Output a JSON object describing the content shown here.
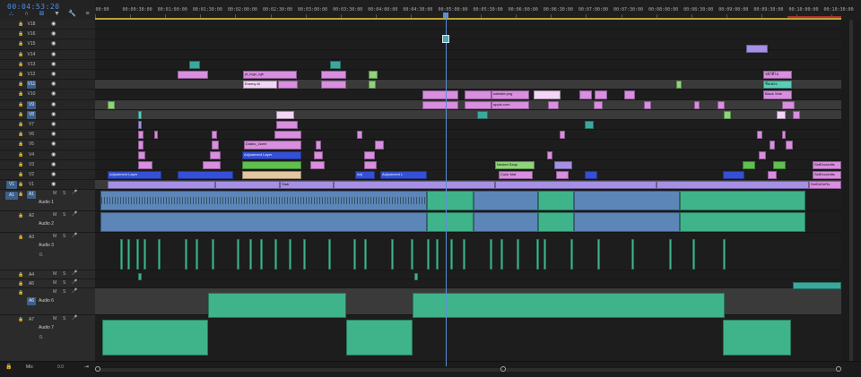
{
  "sequence": {
    "timecode": "00:04:53:20",
    "playhead_time": "00:04:53:20"
  },
  "toolbar": {
    "tools": [
      "snap-icon",
      "linked-selection-icon",
      "add-marker-icon",
      "marker-icon",
      "wrench-icon",
      "settings-icon"
    ]
  },
  "ruler": {
    "ticks": [
      "00:00",
      "00:00:30:00",
      "00:01:00:00",
      "00:01:30:00",
      "00:02:00:00",
      "00:02:30:00",
      "00:03:00:00",
      "00:03:30:00",
      "00:04:00:00",
      "00:04:30:00",
      "00:05:00:00",
      "00:05:30:00",
      "00:06:00:00",
      "00:06:30:00",
      "00:07:00:00",
      "00:07:30:00",
      "00:08:00:00",
      "00:08:30:00",
      "00:09:00:00",
      "00:09:30:00",
      "00:10:00:00",
      "00:10:30:00"
    ]
  },
  "video_tracks": [
    {
      "name": "V18",
      "selected": false
    },
    {
      "name": "V16",
      "selected": false
    },
    {
      "name": "V15",
      "selected": false
    },
    {
      "name": "V14",
      "selected": false
    },
    {
      "name": "V13",
      "selected": false
    },
    {
      "name": "V12",
      "selected": false
    },
    {
      "name": "V11",
      "selected": true
    },
    {
      "name": "V10",
      "selected": false
    },
    {
      "name": "V9",
      "selected": true
    },
    {
      "name": "V8",
      "selected": true
    },
    {
      "name": "V7",
      "selected": false
    },
    {
      "name": "V6",
      "selected": false
    },
    {
      "name": "V5",
      "selected": false
    },
    {
      "name": "V4",
      "selected": false
    },
    {
      "name": "V3",
      "selected": false
    },
    {
      "name": "V2",
      "selected": false
    },
    {
      "name": "V1",
      "selected": false
    }
  ],
  "video_target": "V1",
  "audio_tracks": [
    {
      "name": "A1",
      "label": "Audio 1",
      "volume": ""
    },
    {
      "name": "A2",
      "label": "Audio 2",
      "volume": ""
    },
    {
      "name": "A3",
      "label": "Audio 3",
      "volume": "0."
    },
    {
      "name": "A4",
      "label": "",
      "volume": ""
    },
    {
      "name": "A5",
      "label": "",
      "volume": ""
    },
    {
      "name": "A6",
      "label": "Audio 6",
      "volume": ""
    },
    {
      "name": "A7",
      "label": "Audio 7",
      "volume": "0."
    }
  ],
  "audio_target": "A1",
  "ms_labels": {
    "mute": "M",
    "solo": "S"
  },
  "mix": {
    "label": "Mix",
    "value": "0.0"
  },
  "clip_labels": {
    "yt_logo": "yt_logo_rgb",
    "enemy": "Enemy Al",
    "adjustment1": "Adjustment Layer",
    "adjustment2": "Adjustment Layer",
    "adjustment3": "Adjustment L",
    "diablo": "Diablo_2wetr",
    "website": "website.png",
    "apple": "apple.com",
    "nested": "Nested Sequ",
    "colormat": "Color Mat",
    "bluemask": "Blue Mask",
    "blackvideo": "Black Vide",
    "thaitext": "ชนิวิดีโอ",
    "thaitext2": "ชื่อเพลง",
    "v1_tail": "SetEncredits",
    "v1_tail2": "SetEncredits",
    "v1_tail3": "SetDeDeRo",
    "stab": "Stab",
    "adj_pink": "Adj"
  },
  "colors": {
    "accent": "#4a90e2",
    "playhead": "#5b8fd6",
    "workarea": "#b8a33c"
  }
}
